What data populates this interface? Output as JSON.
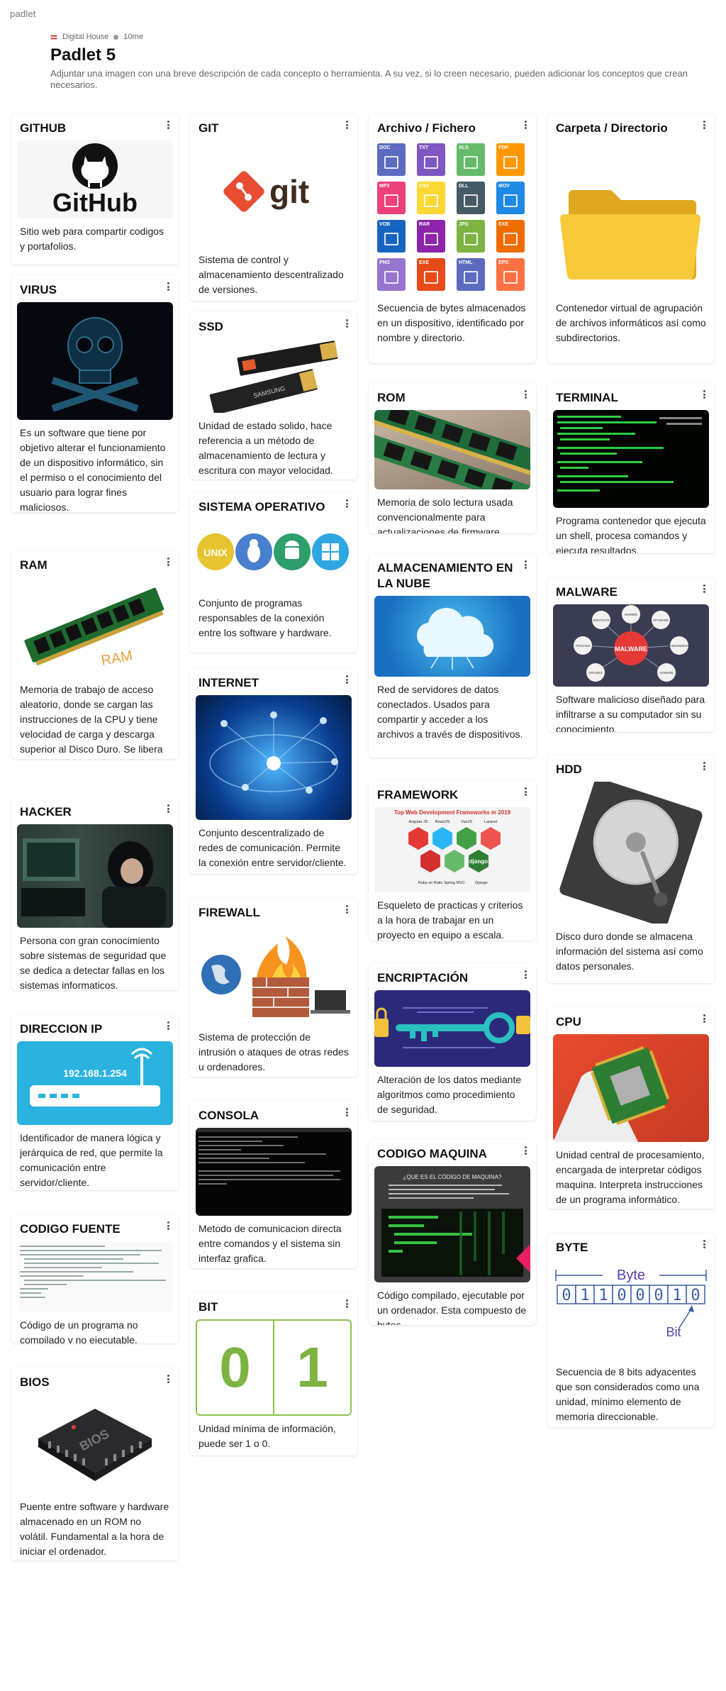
{
  "app": {
    "brand": "padlet"
  },
  "board": {
    "author": "Digital House",
    "time": "10me",
    "title": "Padlet 5",
    "description": "Adjuntar una imagen con una breve descripción de cada concepto o herramienta. A su vez, si lo creen necesario, pueden adicionar los conceptos que crean necesarios."
  },
  "cards": {
    "github": {
      "title": "GITHUB",
      "text": "Sitio web para compartir codigos y portafolios.",
      "image_text": "GitHub"
    },
    "virus": {
      "title": "VIRUS",
      "text": "Es un software que tiene por objetivo alterar el funcionamiento de un dispositivo informático, sin el permiso o el conocimiento del usuario para lograr fines maliciosos."
    },
    "ram": {
      "title": "RAM",
      "text": "Memoria de trabajo de acceso aleatorio, donde se cargan las instrucciones de la CPU y tiene velocidad de carga y descarga superior al Disco Duro. Se libera al apagar la computadora.",
      "image_text": "RAM"
    },
    "hacker": {
      "title": "HACKER",
      "text": "Persona con gran conocimiento sobre sistemas de seguridad que se dedica a detectar fallas en los sistemas informaticos."
    },
    "ip": {
      "title": "DIRECCION IP",
      "text": "Identificador de manera lógica y jerárquica de red, que permite la comunicación entre servidor/cliente.",
      "image_text": "192.168.1.254"
    },
    "codigo_fuente": {
      "title": "CODIGO FUENTE",
      "text": "Código de un programa no compilado y no ejecutable."
    },
    "bios": {
      "title": "BIOS",
      "text": "Puente entre software y hardware almacenado en un ROM no volátil. Fundamental a la hora de iniciar el ordenador.",
      "image_text": "BIOS"
    },
    "git": {
      "title": "GIT",
      "text": "Sistema de control y almacenamiento descentralizado de versiones.",
      "image_text": "git"
    },
    "ssd": {
      "title": "SSD",
      "text": "Unidad de estado solido, hace referencia a un método de almacenamiento de lectura y escritura con mayor velocidad.",
      "image_text": "SAMSUNG"
    },
    "so": {
      "title": "SISTEMA OPERATIVO",
      "text": "Conjunto de programas responsables de la conexión entre los software y hardware.",
      "image_text": "UNIX"
    },
    "internet": {
      "title": "INTERNET",
      "text": "Conjunto descentralizado de redes de comunicación. Permite la conexión entre servidor/cliente."
    },
    "firewall": {
      "title": "FIREWALL",
      "text": "Sistema de protección de intrusión o ataques de otras redes u ordenadores."
    },
    "consola": {
      "title": "CONSOLA",
      "text": "Metodo de comunicacion directa entre comandos y el sistema sin interfaz grafica."
    },
    "bit": {
      "title": "BIT",
      "text": "Unidad mínima de información, puede ser 1 o 0.",
      "zero": "0",
      "one": "1"
    },
    "archivo": {
      "title": "Archivo / Fichero",
      "text": "Secuencia de bytes almacenados en un dispositivo, identificado por nombre y directorio.",
      "file_types": [
        "DOC",
        "TXT",
        "XLS",
        "PDF",
        "MP3",
        "CSV",
        "DLL",
        "MOV",
        "VOB",
        "RAR",
        "JPG",
        "EXE",
        "PNG",
        "EXE",
        "HTML",
        "EPS"
      ]
    },
    "rom": {
      "title": "ROM",
      "text": "Memoria de solo lectura usada convencionalmente para actualizaciones de firmware."
    },
    "nube": {
      "title": "ALMACENAMIENTO EN LA NUBE",
      "text": "Red de servidores de datos conectados. Usados para compartir y acceder a los archivos a través de dispositivos."
    },
    "framework": {
      "title": "FRAMEWORK",
      "text": "Esqueleto de practicas y criterios a la hora de trabajar en un proyecto en equipo a escala.",
      "image_title": "Top Web Development Frameworks in 2019",
      "labels": [
        "Angular JS",
        "ReactJS",
        "VueJS",
        "Laravel",
        "Ruby on Rails",
        "Spring MVC",
        "Django"
      ],
      "django": "django"
    },
    "encriptacion": {
      "title": "ENCRIPTACIÓN",
      "text": "Alteración de los datos mediante algoritmos como procedimiento de seguridad."
    },
    "codigo_maquina": {
      "title": "CODIGO MAQUINA",
      "text": "Código compilado, ejecutable por un ordenador. Esta compuesto de bytes.",
      "image_title": "¿QUE ES EL CÓDIGO DE MAQUINA?"
    },
    "carpeta": {
      "title": "Carpeta / Directorio",
      "text": "Contenedor virtual de agrupación de archivos informáticos así como subdirectorios."
    },
    "terminal": {
      "title": "TERMINAL",
      "text": "Programa contenedor que ejecuta un shell, procesa comandos y ejecuta resultados."
    },
    "malware": {
      "title": "MALWARE",
      "text": "Software malicioso diseñado para infiltrarse a su computador sin su conocimiento.",
      "image_text": "MALWARE",
      "labels": [
        "ROOTKITS",
        "WORMS",
        "SPYWARE",
        "TROJANS",
        "RANSOMWARE",
        "VIRUSES",
        "ADWARE"
      ]
    },
    "hdd": {
      "title": "HDD",
      "text": "Disco duro donde se almacena información del sistema así como datos personales."
    },
    "cpu": {
      "title": "CPU",
      "text": "Unidad central de procesamiento, encargada de interpretar códigos maquina. Interpreta instrucciones de un programa informático."
    },
    "byte": {
      "title": "BYTE",
      "text": "Secuencia de 8 bits adyacentes que son considerados como una unidad, mínimo elemento de memoria direccionable.",
      "byte_label": "Byte",
      "bit_label": "Bit",
      "bits": [
        "0",
        "1",
        "1",
        "0",
        "0",
        "0",
        "1",
        "0"
      ]
    }
  },
  "colors": {
    "accent_green": "#7cb342",
    "page_bg": "#ffffff"
  }
}
